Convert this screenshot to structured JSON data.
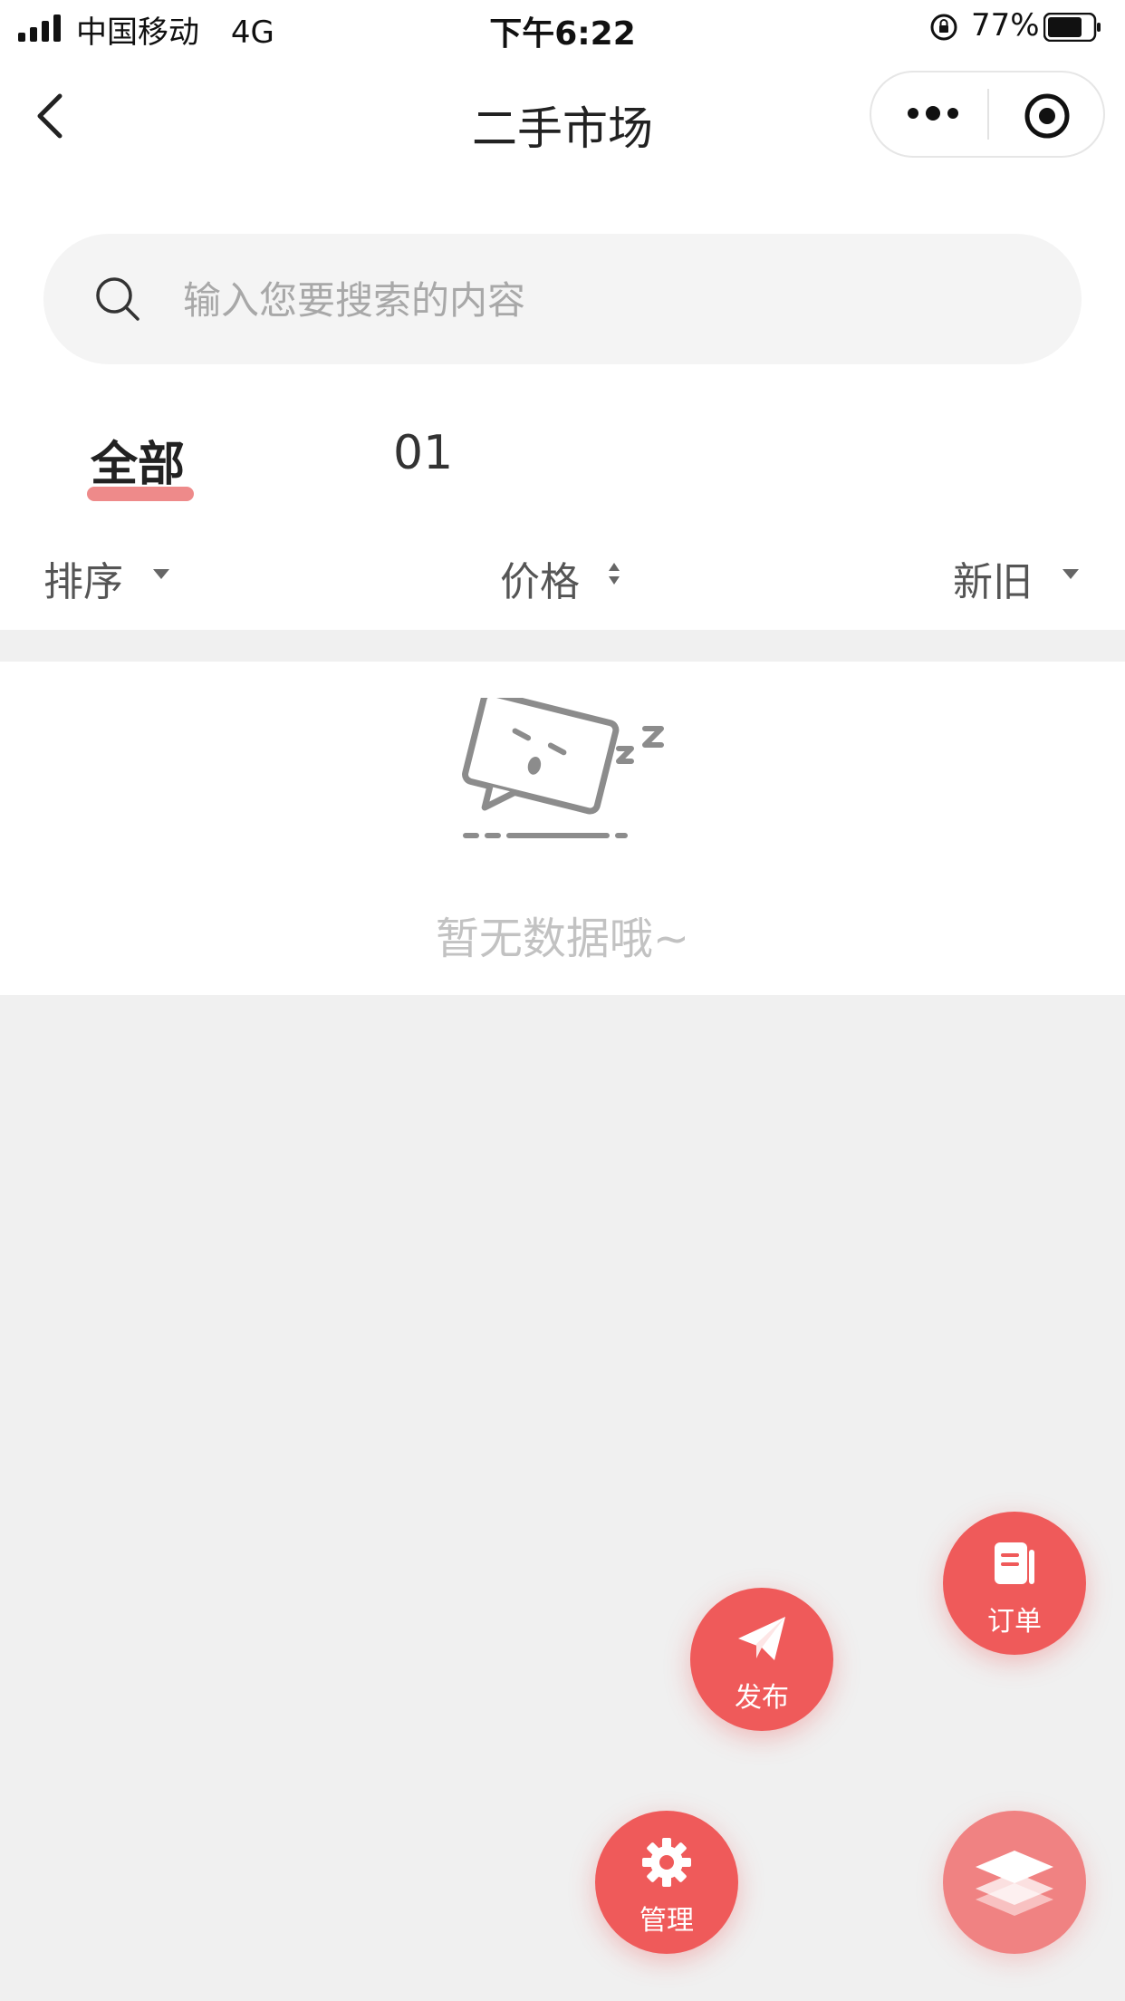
{
  "status_bar": {
    "carrier": "中国移动",
    "network": "4G",
    "time": "下午6:22",
    "battery_percent": "77%",
    "battery_level": 0.77
  },
  "nav": {
    "title": "二手市场"
  },
  "search": {
    "placeholder": "输入您要搜索的内容",
    "value": ""
  },
  "tabs": [
    {
      "label": "全部",
      "active": true
    },
    {
      "label": "01",
      "active": false
    }
  ],
  "filters": {
    "sort": "排序",
    "price": "价格",
    "condition": "新旧"
  },
  "empty_state": {
    "message": "暂无数据哦~"
  },
  "fabs": {
    "order": "订单",
    "publish": "发布",
    "manage": "管理"
  },
  "colors": {
    "accent": "#ef5a5a",
    "accent_light": "#f08282",
    "tab_underline": "#ee8a8a",
    "page_bg": "#f0f0f0"
  },
  "icons": [
    "back-icon",
    "more-icon",
    "target-icon",
    "search-icon",
    "caret-down-icon",
    "sort-updown-icon",
    "sleeping-box-icon",
    "document-icon",
    "paper-plane-icon",
    "gear-icon",
    "layers-icon"
  ]
}
